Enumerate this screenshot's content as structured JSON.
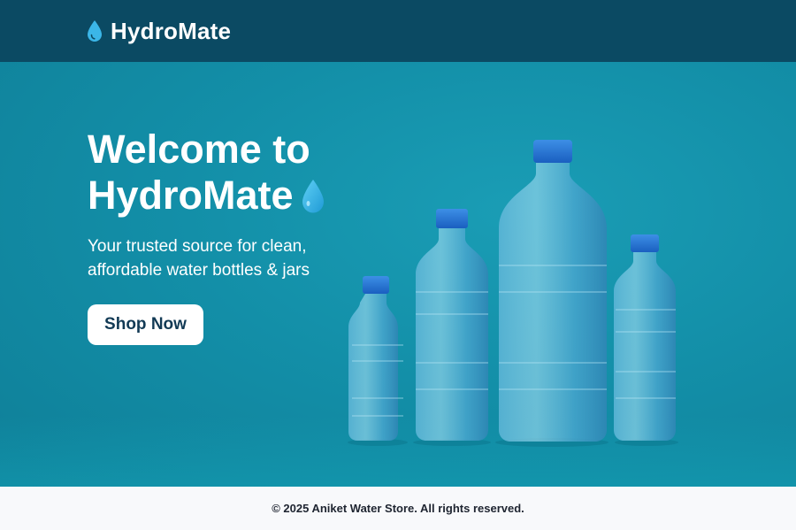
{
  "header": {
    "brand_name": "HydroMate",
    "brand_icon": "water-drop-icon"
  },
  "hero": {
    "title_line1": "Welcome to",
    "title_line2": "HydroMate",
    "title_icon": "water-drop-icon",
    "subtitle_line1": "Your trusted source for clean,",
    "subtitle_line2": "affordable water bottles & jars",
    "cta_label": "Shop Now",
    "image": "water-bottles-illustration"
  },
  "footer": {
    "copyright": "© 2025 Aniket Water Store. All rights reserved."
  },
  "colors": {
    "header_bg": "#0b4a63",
    "hero_bg": "#138fa8",
    "drop": "#3bb6e8",
    "cap": "#1f6fd1",
    "button_bg": "#ffffff",
    "button_text": "#123a55"
  }
}
